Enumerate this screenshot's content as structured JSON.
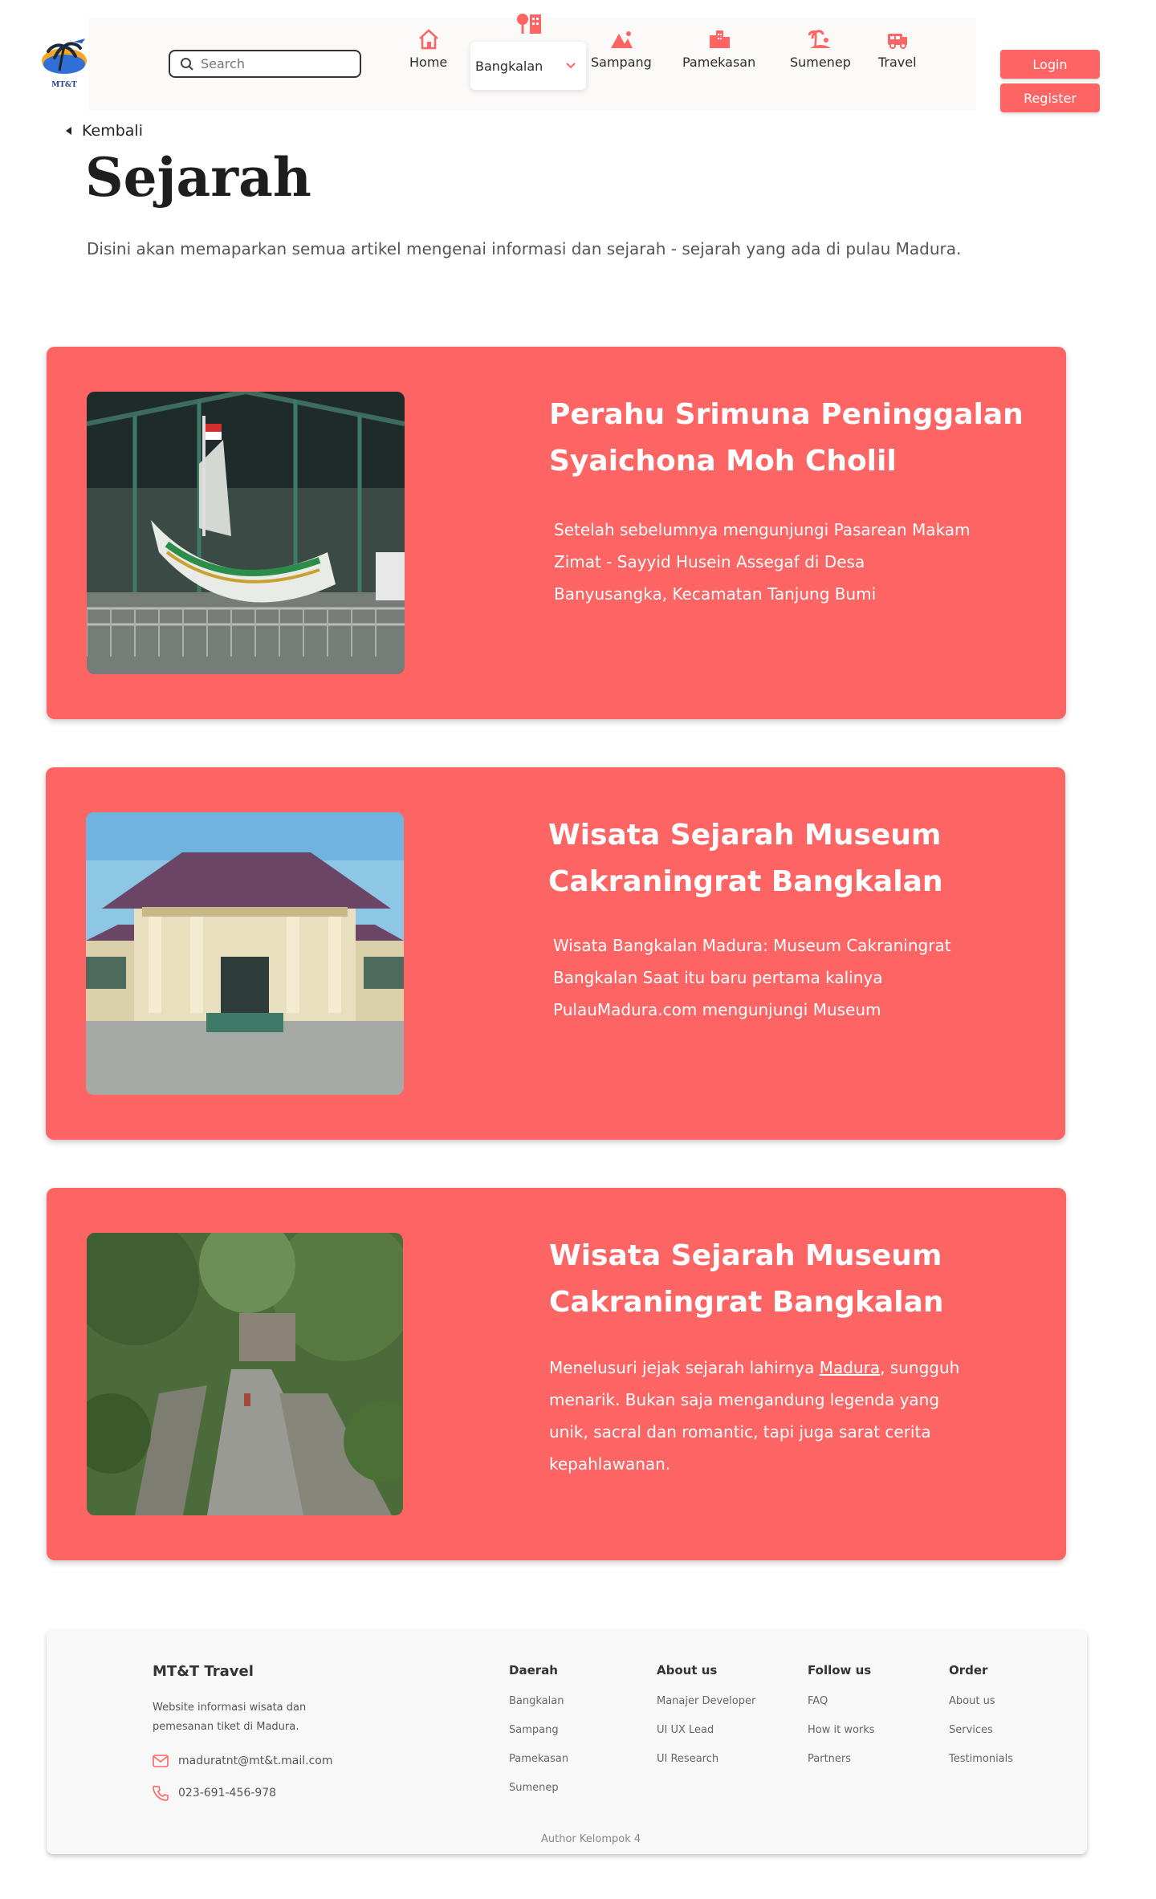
{
  "brand": {
    "logo_text": "MT&T",
    "colors": {
      "accent": "#fd6464",
      "nav_bg": "#fbfaf9",
      "text": "#2b2b2b"
    }
  },
  "header": {
    "search_placeholder": "Search",
    "nav": [
      {
        "label": "Home",
        "icon": "home-icon"
      },
      {
        "label": "Bangkalan",
        "icon": "tree-building-icon"
      },
      {
        "label": "Sampang",
        "icon": "mountain-icon"
      },
      {
        "label": "Pamekasan",
        "icon": "city-icon"
      },
      {
        "label": "Sumenep",
        "icon": "beach-icon"
      },
      {
        "label": "Travel",
        "icon": "bus-icon"
      }
    ],
    "login_label": "Login",
    "register_label": "Register"
  },
  "main": {
    "back_label": "Kembali",
    "title": "Sejarah",
    "description": "Disini akan memaparkan semua artikel mengenai informasi dan sejarah - sejarah yang ada di pulau Madura.",
    "articles": [
      {
        "title": "Perahu Srimuna Peninggalan Syaichona Moh Cholil",
        "text": "Setelah sebelumnya mengunjungi Pasarean Makam Zimat - Sayyid Husein Assegaf di Desa Banyusangka, Kecamatan Tanjung Bumi"
      },
      {
        "title": "Wisata Sejarah Museum Cakraningrat Bangkalan",
        "text": "Wisata Bangkalan Madura: Museum Cakraningrat Bangkalan Saat itu baru pertama kalinya PulauMadura.com mengunjungi Museum"
      },
      {
        "title": "Wisata Sejarah Museum Cakraningrat Bangkalan",
        "text_before": "Menelusuri jejak sejarah lahirnya ",
        "link": "Madura",
        "text_after": ", sungguh menarik. Bukan saja mengandung legenda yang unik, sacral dan romantic, tapi juga sarat cerita kepahlawanan."
      }
    ]
  },
  "footer": {
    "brand": "MT&T Travel",
    "tagline": "Website informasi wisata dan pemesanan tiket di Madura.",
    "email": "maduratnt@mt&t.mail.com",
    "phone": "023-691-456-978",
    "columns": [
      {
        "title": "Daerah",
        "links": [
          "Bangkalan",
          "Sampang",
          "Pamekasan",
          "Sumenep"
        ]
      },
      {
        "title": "About us",
        "links": [
          "Manajer Developer",
          "UI UX Lead",
          "UI Research"
        ]
      },
      {
        "title": "Follow us",
        "links": [
          "FAQ",
          "How it works",
          "Partners"
        ]
      },
      {
        "title": "Order",
        "links": [
          "About us",
          "Services",
          "Testimonials"
        ]
      }
    ],
    "author": "Author Kelompok 4"
  }
}
